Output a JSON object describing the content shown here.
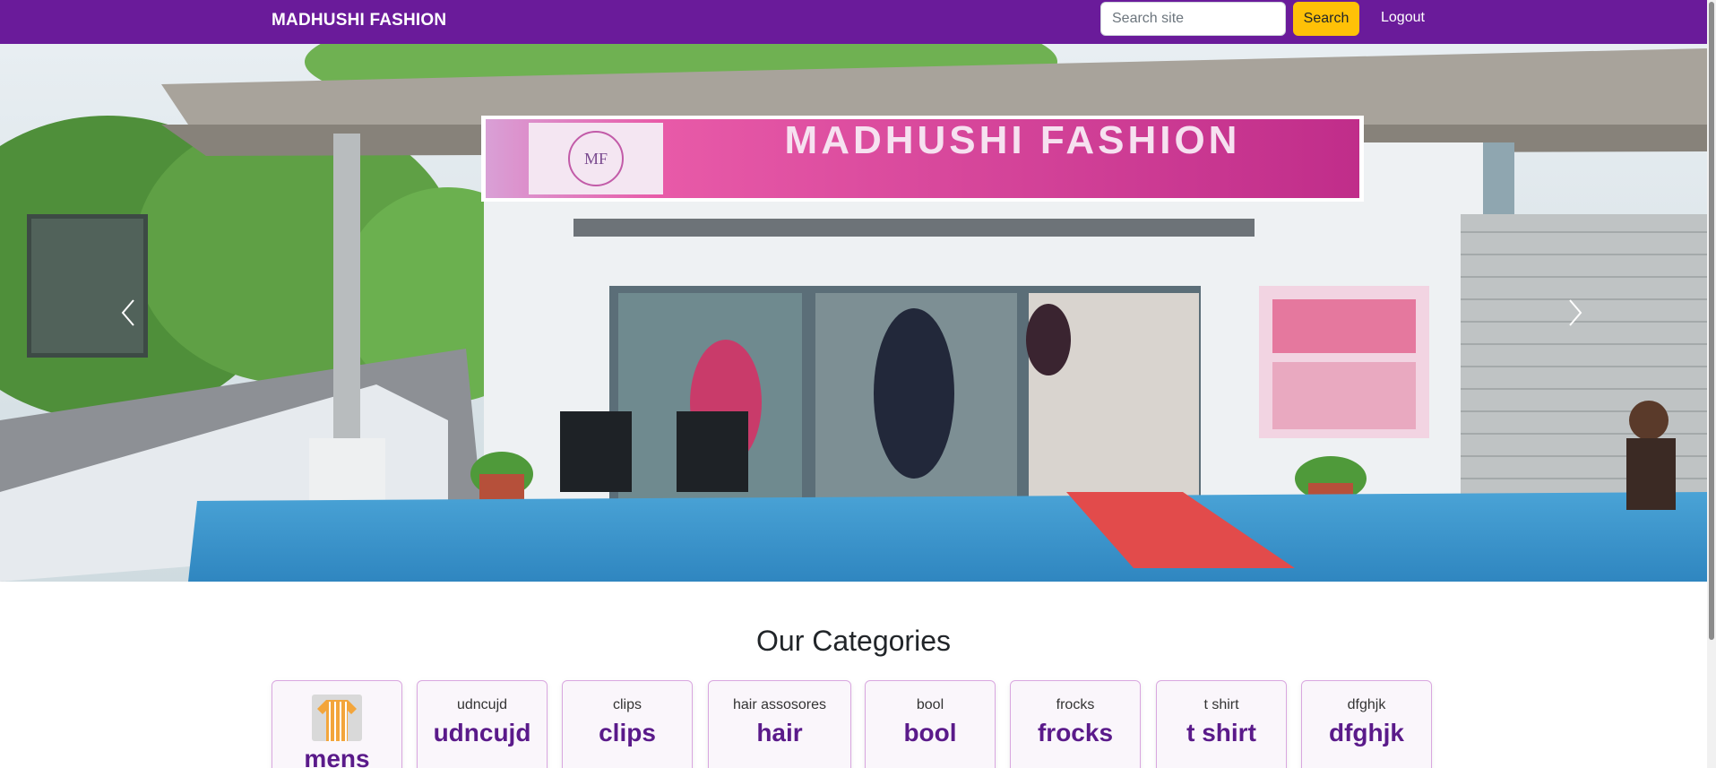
{
  "navbar": {
    "brand": "MADHUSHI FASHION",
    "search_placeholder": "Search site",
    "search_button": "Search",
    "logout": "Logout"
  },
  "carousel": {
    "prev_icon": "chevron-left-icon",
    "next_icon": "chevron-right-icon",
    "slide": {
      "sign_title": "MADHUSHI FASHION",
      "sign_logo": "MF"
    }
  },
  "categories": {
    "title": "Our Categories",
    "items": [
      {
        "alt": "",
        "name": "mens",
        "has_image": true
      },
      {
        "alt": "udncujd",
        "name": "udncujd"
      },
      {
        "alt": "clips",
        "name": "clips"
      },
      {
        "alt": "hair assosores",
        "name": "hair"
      },
      {
        "alt": "bool",
        "name": "bool"
      },
      {
        "alt": "frocks",
        "name": "frocks"
      },
      {
        "alt": "t shirt",
        "name": "t shirt"
      },
      {
        "alt": "dfghjk",
        "name": "dfghjk"
      }
    ]
  },
  "colors": {
    "navbar": "#6a1b9a",
    "search_button": "#ffc107",
    "category_text": "#5a1a8a"
  }
}
